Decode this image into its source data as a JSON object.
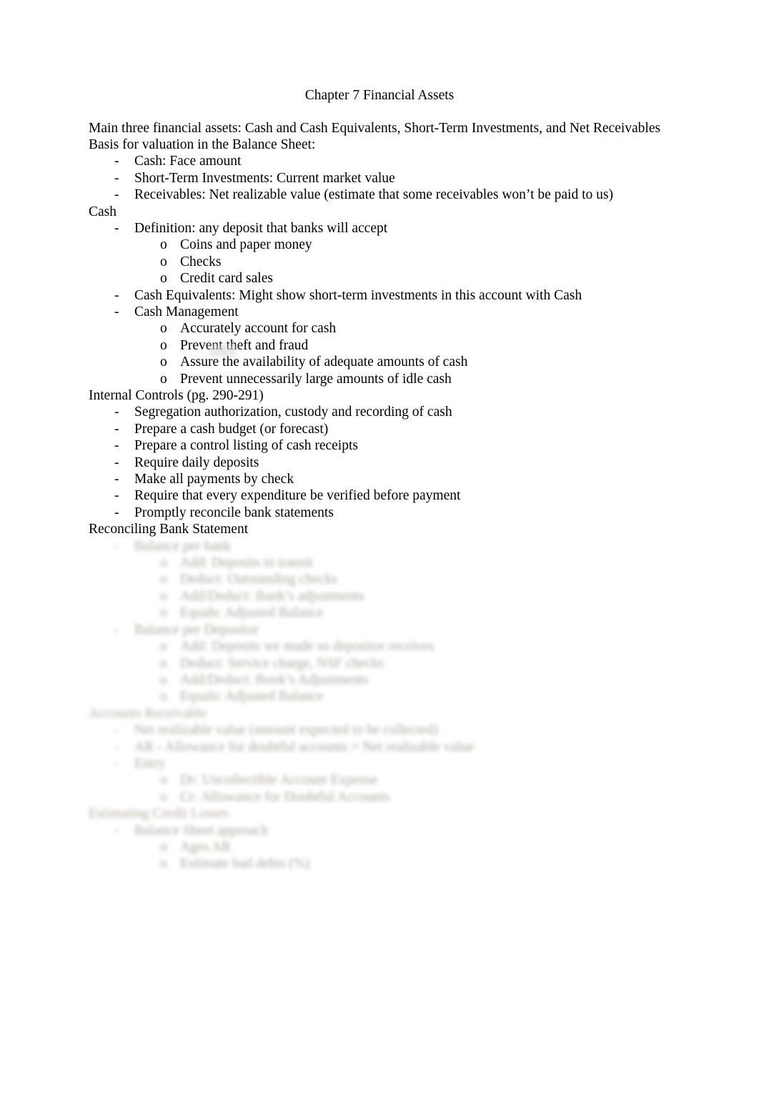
{
  "document": {
    "title": "Chapter 7 Financial Assets",
    "blocks": [
      {
        "level": 0,
        "marker": "",
        "text": "Main three financial assets: Cash and Cash Equivalents, Short-Term Investments, and Net Receivables",
        "blur": false
      },
      {
        "level": 0,
        "marker": "",
        "text": "Basis for valuation in the Balance Sheet:",
        "blur": false
      },
      {
        "level": 1,
        "marker": "-",
        "text": "Cash: Face amount",
        "blur": false
      },
      {
        "level": 1,
        "marker": "-",
        "text": "Short-Term Investments: Current market value",
        "blur": false
      },
      {
        "level": 1,
        "marker": "-",
        "text": "Receivables: Net realizable value (estimate that some receivables won’t be paid to us)",
        "blur": false
      },
      {
        "level": 0,
        "marker": "",
        "text": "Cash",
        "blur": false
      },
      {
        "level": 1,
        "marker": "-",
        "text": "Definition: any deposit that banks will accept",
        "blur": false
      },
      {
        "level": 2,
        "marker": "o",
        "text": "Coins and paper money",
        "blur": false
      },
      {
        "level": 2,
        "marker": "o",
        "text": "Checks",
        "blur": false
      },
      {
        "level": 2,
        "marker": "o",
        "text": "Credit card sales",
        "blur": false
      },
      {
        "level": 1,
        "marker": "-",
        "text": "Cash Equivalents: Might show short-term investments in this account with Cash",
        "blur": false
      },
      {
        "level": 1,
        "marker": "-",
        "text": "Cash Management",
        "blur": false
      },
      {
        "level": 2,
        "marker": "o",
        "text": "Accurately account for cash",
        "blur": false
      },
      {
        "level": 2,
        "marker": "o",
        "text": "Prevent theft and fraud",
        "blur": false
      },
      {
        "level": 2,
        "marker": "o",
        "text": "Assure the availability of adequate amounts of cash",
        "blur": false
      },
      {
        "level": 2,
        "marker": "o",
        "text": "Prevent unnecessarily large amounts of idle cash",
        "blur": false
      },
      {
        "level": 0,
        "marker": "",
        "text": "Internal Controls (pg. 290-291)",
        "blur": false
      },
      {
        "level": 1,
        "marker": "-",
        "text": "Segregation authorization, custody and recording of cash",
        "blur": false
      },
      {
        "level": 1,
        "marker": "-",
        "text": "Prepare a cash budget (or forecast)",
        "blur": false
      },
      {
        "level": 1,
        "marker": "-",
        "text": "Prepare a control listing of cash receipts",
        "blur": false
      },
      {
        "level": 1,
        "marker": "-",
        "text": "Require daily deposits",
        "blur": false
      },
      {
        "level": 1,
        "marker": "-",
        "text": "Make all payments by check",
        "blur": false
      },
      {
        "level": 1,
        "marker": "-",
        "text": "Require that every expenditure be verified before payment",
        "blur": false
      },
      {
        "level": 1,
        "marker": "-",
        "text": "Promptly reconcile bank statements",
        "blur": false
      },
      {
        "level": 0,
        "marker": "",
        "text": "Reconciling Bank Statement",
        "blur": false
      },
      {
        "level": 1,
        "marker": "-",
        "text": "Balance per bank",
        "blur": true
      },
      {
        "level": 2,
        "marker": "o",
        "text": "Add: Deposits in transit",
        "blur": true
      },
      {
        "level": 2,
        "marker": "o",
        "text": "Deduct: Outstanding checks",
        "blur": true
      },
      {
        "level": 2,
        "marker": "o",
        "text": "Add/Deduct: Bank’s adjustments",
        "blur": true
      },
      {
        "level": 2,
        "marker": "o",
        "text": "Equals: Adjusted Balance",
        "blur": true
      },
      {
        "level": 1,
        "marker": "-",
        "text": "Balance per Depositor",
        "blur": true
      },
      {
        "level": 2,
        "marker": "o",
        "text": "Add: Deposits we made so depositor receives",
        "blur": true
      },
      {
        "level": 2,
        "marker": "o",
        "text": "Deduct: Service charge, NSF checks",
        "blur": true
      },
      {
        "level": 2,
        "marker": "o",
        "text": "Add/Deduct: Book’s Adjustments",
        "blur": true
      },
      {
        "level": 2,
        "marker": "o",
        "text": "Equals: Adjusted Balance",
        "blur": true
      },
      {
        "level": 0,
        "marker": "",
        "text": "Accounts Receivable",
        "blur": true
      },
      {
        "level": 1,
        "marker": "-",
        "text": "Net realizable value (amount expected to be collected)",
        "blur": true
      },
      {
        "level": 1,
        "marker": "-",
        "text": "AR - Allowance for doubtful accounts = Net realizable value",
        "blur": true
      },
      {
        "level": 1,
        "marker": "-",
        "text": "Entry",
        "blur": true
      },
      {
        "level": 2,
        "marker": "o",
        "text": "Dr: Uncollectible Account Expense",
        "blur": true
      },
      {
        "level": 2,
        "marker": "o",
        "text": "Cr: Allowance for Doubtful Accounts",
        "blur": true
      },
      {
        "level": 0,
        "marker": "",
        "text": "Estimating Credit Losses",
        "blur": true
      },
      {
        "level": 1,
        "marker": "-",
        "text": "Balance Sheet approach",
        "blur": true
      },
      {
        "level": 2,
        "marker": "o",
        "text": "Ages AR",
        "blur": true
      },
      {
        "level": 2,
        "marker": "o",
        "text": "Estimate bad debts (%)",
        "blur": true
      }
    ]
  }
}
